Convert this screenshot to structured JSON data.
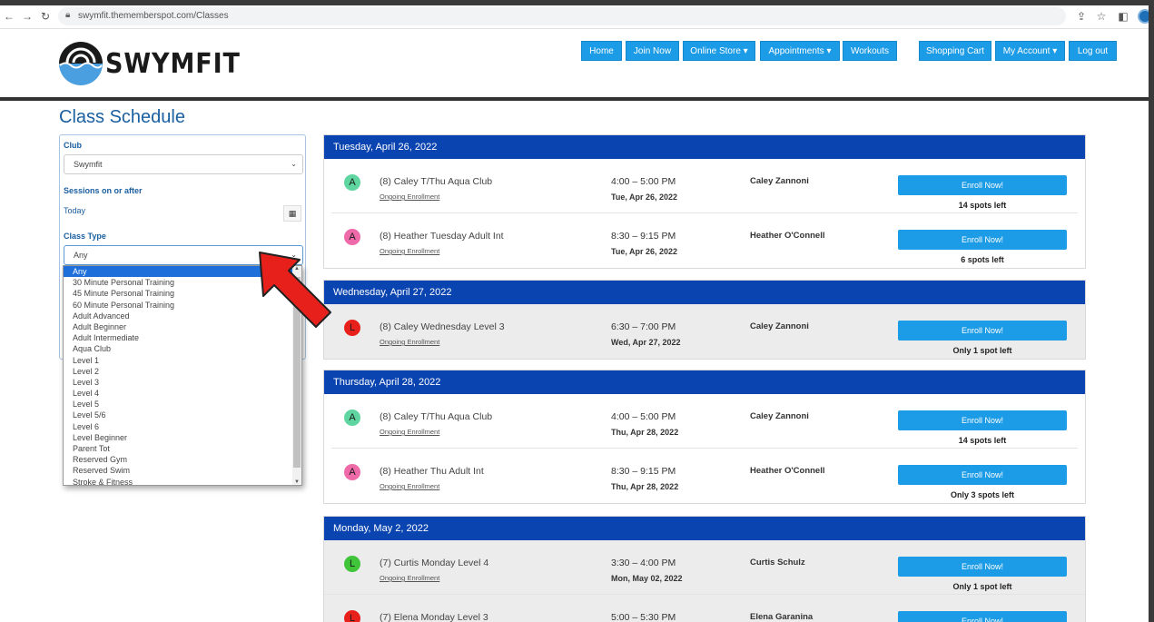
{
  "browser": {
    "url": "swymfit.thememberspot.com/Classes"
  },
  "header": {
    "logo_text": "SWYMFIT",
    "nav": [
      {
        "label": "Home"
      },
      {
        "label": "Join Now"
      },
      {
        "label": "Online Store ▾"
      },
      {
        "label": "Appointments ▾"
      },
      {
        "label": "Workouts"
      },
      {
        "label": "Shopping Cart"
      },
      {
        "label": "My Account ▾"
      },
      {
        "label": "Log out"
      }
    ]
  },
  "page": {
    "title": "Class Schedule"
  },
  "filters": {
    "club_label": "Club",
    "club_value": "Swymfit",
    "sessions_label": "Sessions on or after",
    "sessions_value": "Today",
    "class_type_label": "Class Type",
    "class_type_value": "Any",
    "class_type_options": [
      "Any",
      "30 Minute Personal Training",
      "45 Minute Personal Training",
      "60 Minute Personal Training",
      "Adult Advanced",
      "Adult Beginner",
      "Adult Intermediate",
      "Aqua Club",
      "Level 1",
      "Level 2",
      "Level 3",
      "Level 4",
      "Level 5",
      "Level 5/6",
      "Level 6",
      "Level Beginner",
      "Parent Tot",
      "Reserved Gym",
      "Reserved Swim",
      "Stroke & Fitness"
    ]
  },
  "schedule": {
    "days": [
      {
        "heading": "Tuesday, April 26, 2022",
        "classes": [
          {
            "badge": "A",
            "badge_color": "#5fd6a0",
            "name": "(8) Caley T/Thu Aqua Club",
            "sub": "Ongoing Enrollment",
            "time": "4:00 – 5:00 PM",
            "date": "Tue, Apr 26, 2022",
            "instructor": "Caley Zannoni",
            "button": "Enroll Now!",
            "spots": "14 spots left"
          },
          {
            "badge": "A",
            "badge_color": "#ef6aa8",
            "name": "(8) Heather Tuesday Adult Int",
            "sub": "Ongoing Enrollment",
            "time": "8:30 – 9:15 PM",
            "date": "Tue, Apr 26, 2022",
            "instructor": "Heather O'Connell",
            "button": "Enroll Now!",
            "spots": "6 spots left"
          }
        ]
      },
      {
        "heading": "Wednesday, April 27, 2022",
        "classes": [
          {
            "badge": "L",
            "badge_color": "#e8201c",
            "name": "(8) Caley Wednesday Level 3",
            "sub": "Ongoing Enrollment",
            "time": "6:30 – 7:00 PM",
            "date": "Wed, Apr 27, 2022",
            "instructor": "Caley Zannoni",
            "button": "Enroll Now!",
            "spots": "Only 1 spot left"
          }
        ]
      },
      {
        "heading": "Thursday, April 28, 2022",
        "classes": [
          {
            "badge": "A",
            "badge_color": "#5fd6a0",
            "name": "(8) Caley T/Thu Aqua Club",
            "sub": "Ongoing Enrollment",
            "time": "4:00 – 5:00 PM",
            "date": "Thu, Apr 28, 2022",
            "instructor": "Caley Zannoni",
            "button": "Enroll Now!",
            "spots": "14 spots left"
          },
          {
            "badge": "A",
            "badge_color": "#ef6aa8",
            "name": "(8) Heather Thu Adult Int",
            "sub": "Ongoing Enrollment",
            "time": "8:30 – 9:15 PM",
            "date": "Thu, Apr 28, 2022",
            "instructor": "Heather O'Connell",
            "button": "Enroll Now!",
            "spots": "Only 3 spots left"
          }
        ]
      },
      {
        "heading": "Monday, May 2, 2022",
        "classes": [
          {
            "badge": "L",
            "badge_color": "#3fc43a",
            "name": "(7) Curtis Monday Level 4",
            "sub": "Ongoing Enrollment",
            "time": "3:30 – 4:00 PM",
            "date": "Mon, May 02, 2022",
            "instructor": "Curtis Schulz",
            "button": "Enroll Now!",
            "spots": "Only 1 spot left"
          },
          {
            "badge": "L",
            "badge_color": "#e8201c",
            "name": "(7) Elena Monday Level 3",
            "sub": "",
            "time": "5:00 – 5:30 PM",
            "date": "",
            "instructor": "Elena Garanina",
            "button": "Enroll Now!",
            "spots": ""
          }
        ]
      }
    ]
  },
  "colors": {
    "accent": "#1c9be6",
    "day_header": "#0a44b0",
    "title": "#1a5fa0",
    "arrow": "#e8201c"
  }
}
